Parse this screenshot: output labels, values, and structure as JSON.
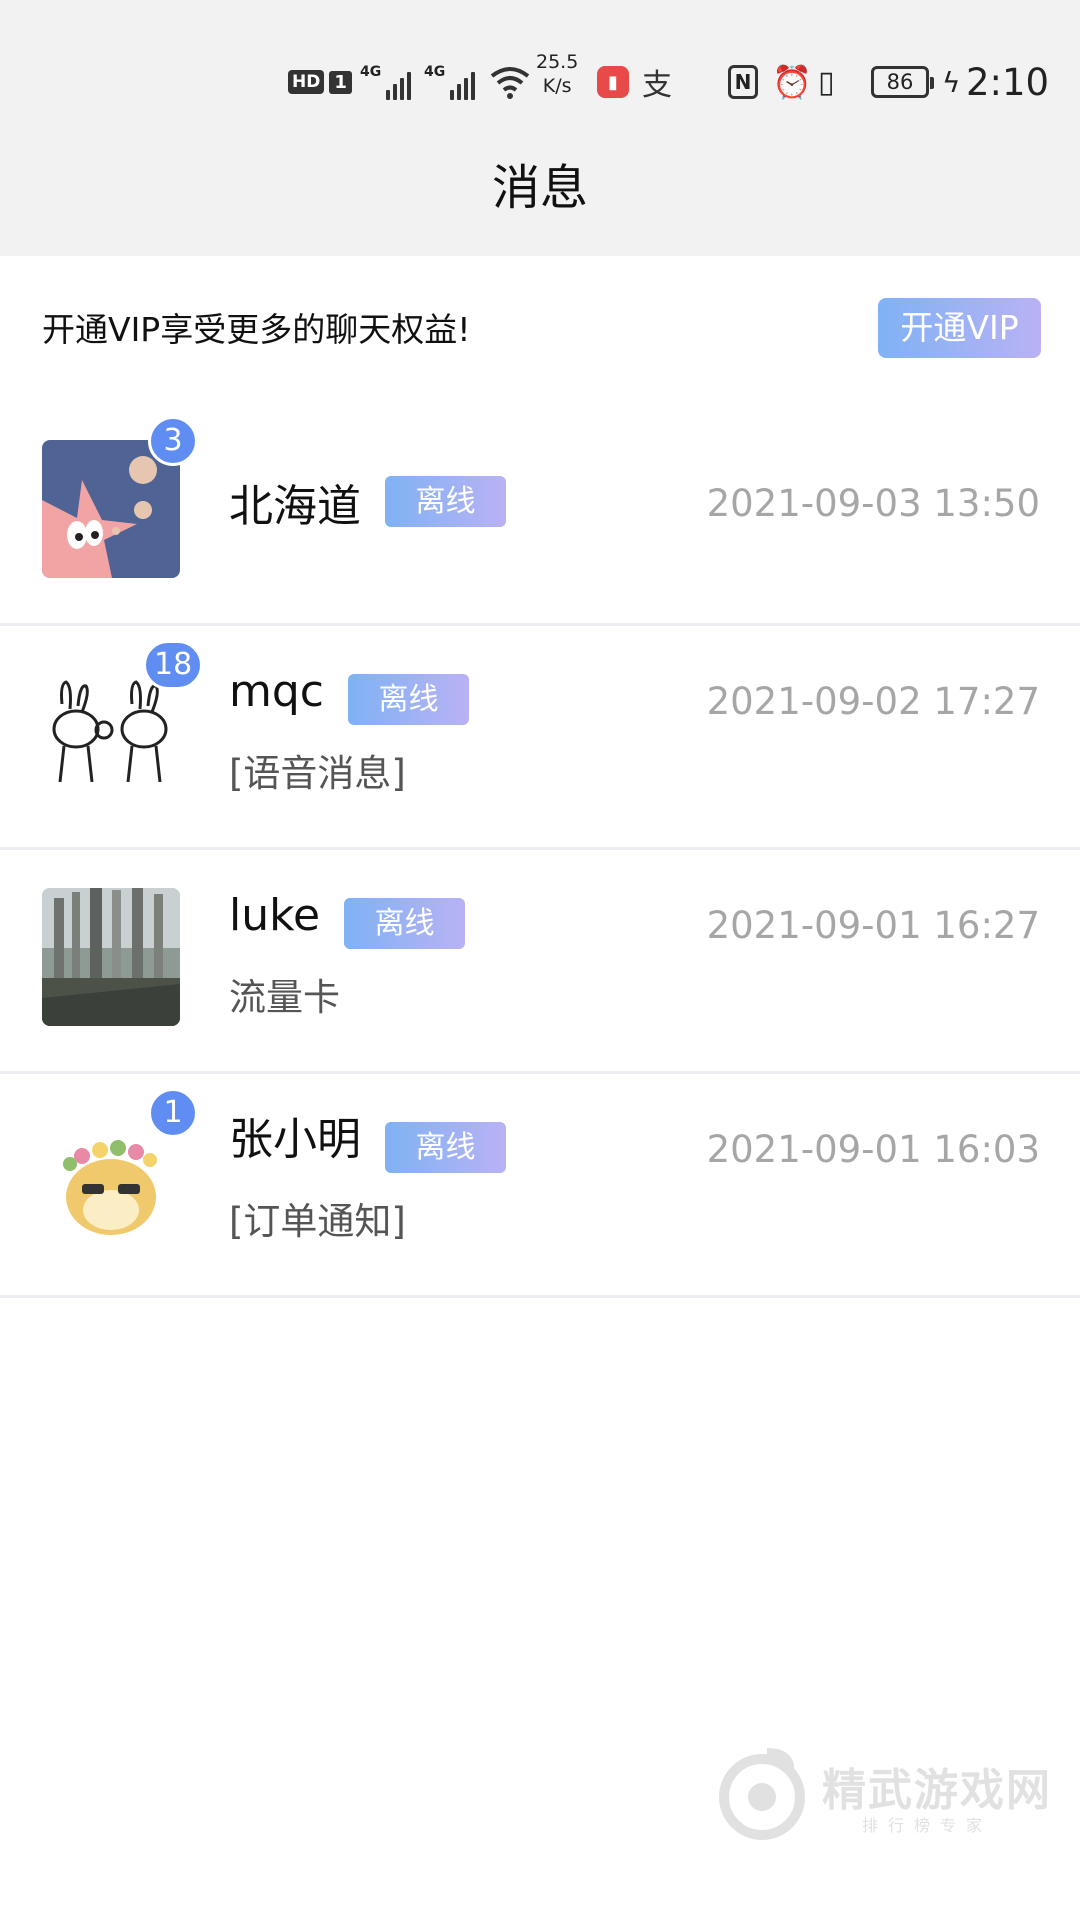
{
  "status_bar": {
    "hd": "HD",
    "sim": "1",
    "network1": "4G",
    "network2": "4G",
    "speed_value": "25.5",
    "speed_unit": "K/s",
    "pay_glyph": "支",
    "nfc": "N",
    "battery": "86",
    "time": "2:10",
    "icons": [
      "hd-icon",
      "signal-icon",
      "wifi-icon",
      "book-app-icon",
      "pay-app-icon",
      "nfc-icon",
      "alarm-icon",
      "vibrate-icon",
      "battery-icon",
      "charging-icon"
    ]
  },
  "header": {
    "title": "消息"
  },
  "vip": {
    "text": "开通VIP享受更多的聊天权益!",
    "button": "开通VIP"
  },
  "chats": [
    {
      "name": "北海道",
      "status": "离线",
      "time": "2021-09-03 13:50",
      "preview": "",
      "unread": "3",
      "avatar": "patrick-star-avatar"
    },
    {
      "name": "mqc",
      "status": "离线",
      "time": "2021-09-02 17:27",
      "preview": "[语音消息]",
      "unread": "18",
      "avatar": "rabbit-sketch-avatar"
    },
    {
      "name": "luke",
      "status": "离线",
      "time": "2021-09-01 16:27",
      "preview": "流量卡",
      "unread": "",
      "avatar": "building-photo-avatar"
    },
    {
      "name": "张小明",
      "status": "离线",
      "time": "2021-09-01 16:03",
      "preview": "[订单通知]",
      "unread": "1",
      "avatar": "shiba-flower-avatar"
    }
  ],
  "watermark": {
    "name": "精武游戏网",
    "sub": "排行榜专家"
  },
  "colors": {
    "accent": "#5f8df1",
    "tag_start": "#7fb2f4",
    "tag_end": "#b9b2f4",
    "time_gray": "#a6a6a6"
  }
}
